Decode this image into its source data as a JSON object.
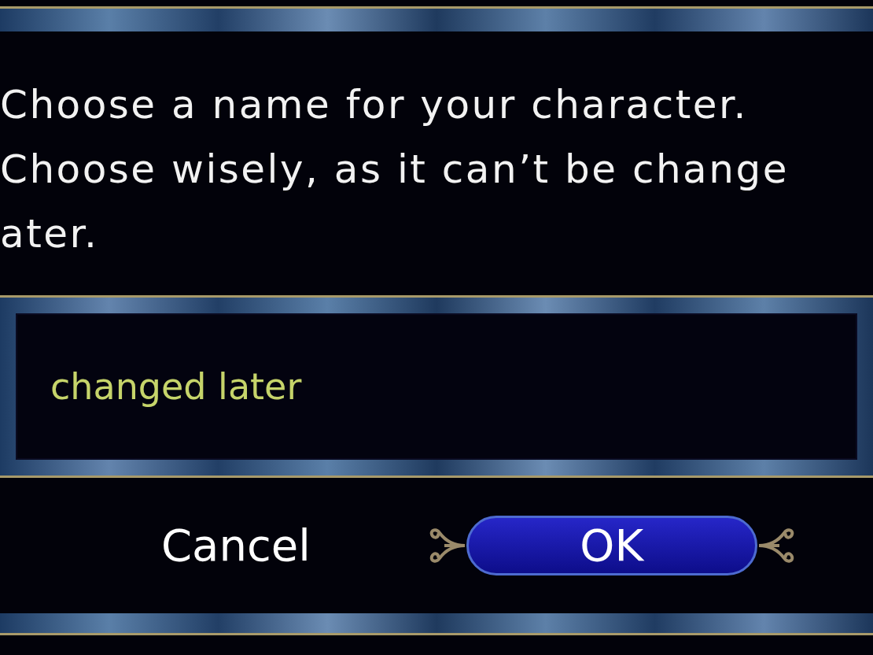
{
  "prompt": {
    "lines": [
      "Choose a name for your character.",
      "Choose wisely, as it can’t be change",
      "ater."
    ]
  },
  "name_field": {
    "value": "changed later"
  },
  "buttons": [
    {
      "label": "Cancel",
      "selected": false
    },
    {
      "label": "OK",
      "selected": true
    }
  ]
}
